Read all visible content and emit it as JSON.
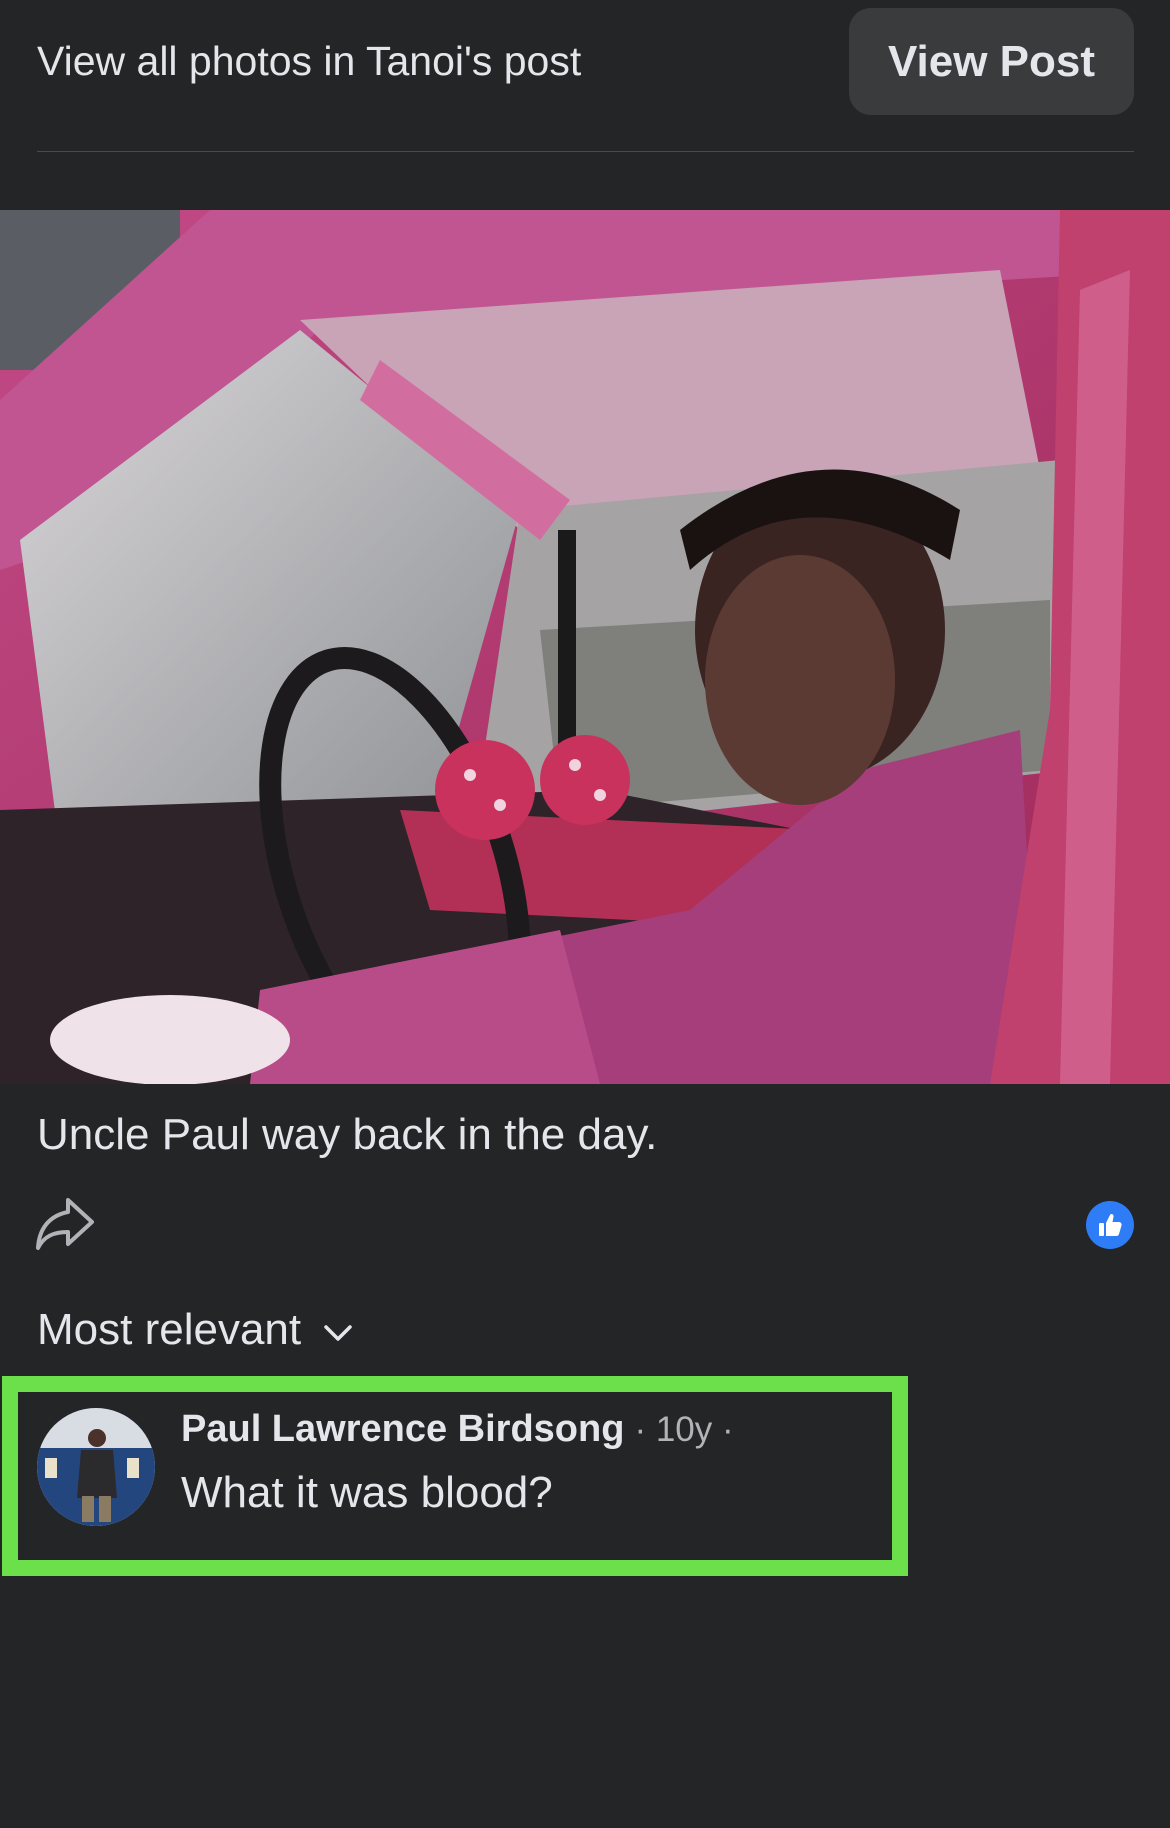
{
  "header": {
    "label": "View all photos in Tanoi's post",
    "view_post_label": "View Post"
  },
  "photo": {
    "caption": "Uncle Paul way back in the day."
  },
  "actions": {
    "share_icon": "share-icon",
    "like_icon": "thumbs-up-icon",
    "like_color": "#2e7df6"
  },
  "comments_section": {
    "sort_label": "Most relevant",
    "sort_icon": "chevron-down-icon"
  },
  "comments": [
    {
      "author": "Paul Lawrence Birdsong",
      "meta": "· 10y ·",
      "text": "What it was blood?"
    }
  ],
  "colors": {
    "background": "#242526",
    "button_bg": "#3a3b3c",
    "highlight": "#6ce04b"
  }
}
